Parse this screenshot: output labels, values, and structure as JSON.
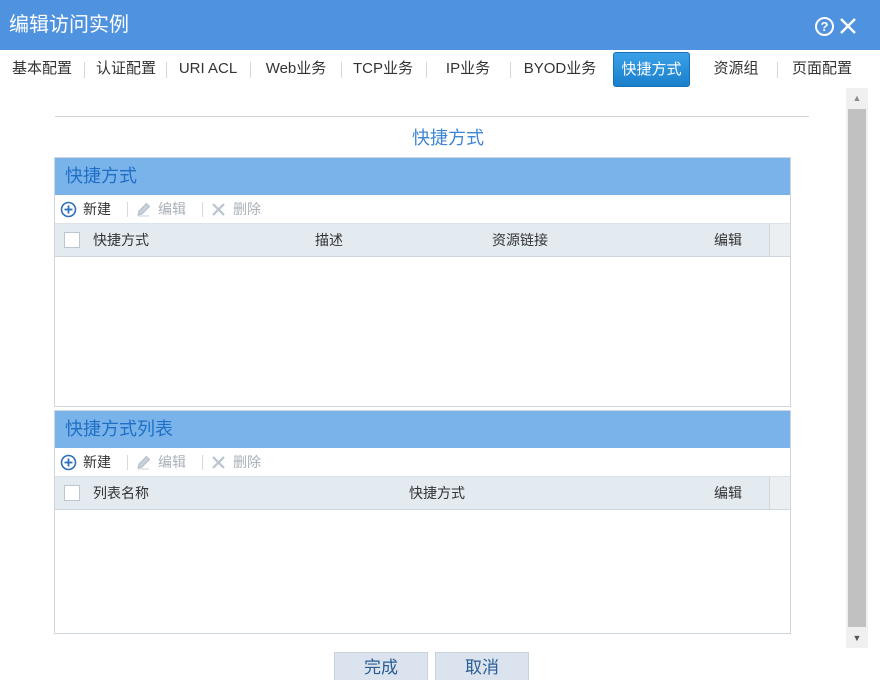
{
  "window": {
    "title": "编辑访问实例",
    "help_glyph": "?"
  },
  "tabs": [
    {
      "label": "基本配置"
    },
    {
      "label": "认证配置"
    },
    {
      "label": "URI ACL"
    },
    {
      "label": "Web业务"
    },
    {
      "label": "TCP业务"
    },
    {
      "label": "IP业务"
    },
    {
      "label": "BYOD业务"
    },
    {
      "label": "快捷方式",
      "active": true
    },
    {
      "label": "资源组"
    },
    {
      "label": "页面配置"
    }
  ],
  "section": {
    "title": "快捷方式"
  },
  "shortcut_panel": {
    "header": "快捷方式",
    "toolbar": {
      "new": "新建",
      "edit": "编辑",
      "delete": "删除"
    },
    "columns": [
      "快捷方式",
      "描述",
      "资源链接",
      "编辑"
    ],
    "rows": []
  },
  "shortcut_list_panel": {
    "header": "快捷方式列表",
    "toolbar": {
      "new": "新建",
      "edit": "编辑",
      "delete": "删除"
    },
    "columns": [
      "列表名称",
      "快捷方式",
      "编辑"
    ],
    "rows": []
  },
  "footer": {
    "finish": "完成",
    "cancel": "取消"
  },
  "colors": {
    "titlebar": "#4f92df",
    "panel_header": "#7ab3ea",
    "active_tab": "#1b80cc",
    "accent_text": "#3f86d6"
  }
}
